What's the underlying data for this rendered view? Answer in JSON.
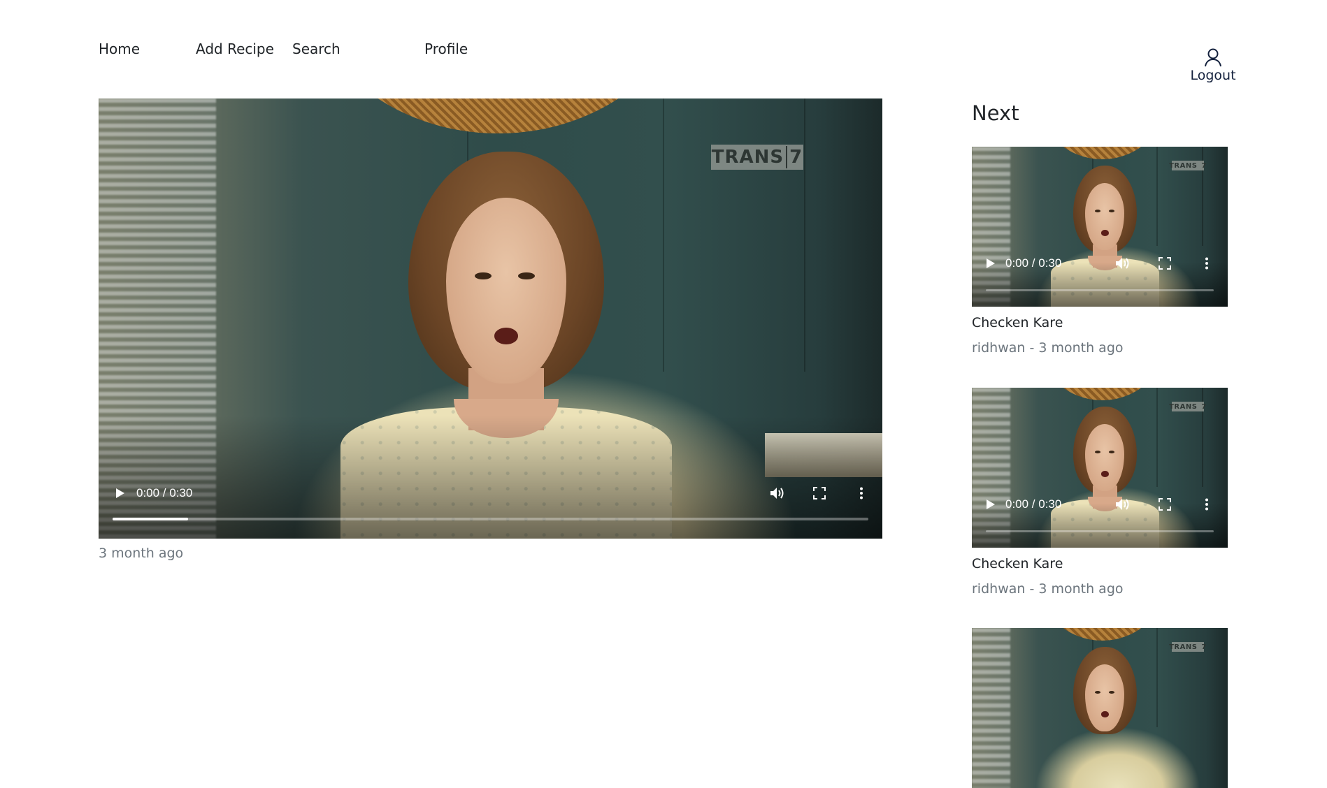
{
  "nav": {
    "links": [
      "Home",
      "Add Recipe",
      "Search",
      "Profile"
    ],
    "logout_label": "Logout",
    "logout_icon": "user-icon"
  },
  "main_video": {
    "time": "0:00 / 0:30",
    "progress": 0.1,
    "logo": {
      "text": "TRANS",
      "number": "7"
    },
    "meta": "3 month ago"
  },
  "sidebar": {
    "title": "Next",
    "items": [
      {
        "time": "0:00 / 0:30",
        "progress": 0,
        "title": "Checken Kare",
        "subtitle": "ridhwan - 3 month ago",
        "logo": {
          "text": "TRANS",
          "number": "7"
        }
      },
      {
        "time": "0:00 / 0:30",
        "progress": 0,
        "title": "Checken Kare",
        "subtitle": "ridhwan - 3 month ago",
        "logo": {
          "text": "TRANS",
          "number": "7"
        }
      },
      {
        "logo": {
          "text": "TRANS",
          "number": "7"
        }
      }
    ]
  },
  "colors": {
    "text": "#212529",
    "muted": "#6c757d",
    "logout": "#14213d"
  }
}
